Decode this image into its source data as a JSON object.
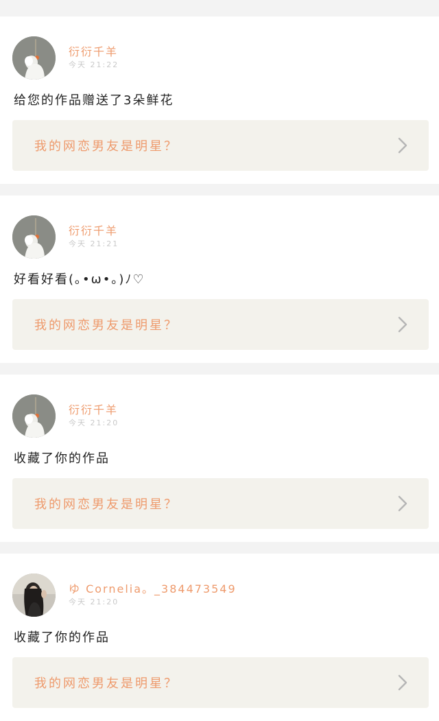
{
  "notifications": [
    {
      "username": "衍衍千羊",
      "timestamp": "今天 21:22",
      "message": "给您的作品赠送了3朵鲜花",
      "work_title": "我的网恋男友是明星？",
      "avatar": "white-figure"
    },
    {
      "username": "衍衍千羊",
      "timestamp": "今天 21:21",
      "message": "好看好看(｡•ω•｡)ﾉ♡",
      "work_title": "我的网恋男友是明星？",
      "avatar": "white-figure"
    },
    {
      "username": "衍衍千羊",
      "timestamp": "今天 21:20",
      "message": "收藏了你的作品",
      "work_title": "我的网恋男友是明星？",
      "avatar": "white-figure"
    },
    {
      "username": "ゆ Cornelia。_384473549",
      "timestamp": "今天 21:20",
      "message": "收藏了你的作品",
      "work_title": "我的网恋男友是明星？",
      "avatar": "dark-hair-girl"
    }
  ],
  "colors": {
    "accent": "#ee9a6c",
    "link_background": "#f3f2ec",
    "page_background": "#f3f3f3",
    "chevron": "#b5b5b5"
  },
  "icons": {
    "chevron": "chevron-right-icon"
  }
}
